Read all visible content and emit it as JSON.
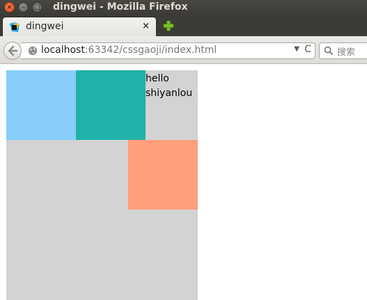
{
  "window": {
    "title": "dingwei - Mozilla Firefox",
    "close_glyph": "×",
    "min_glyph": "–",
    "max_glyph": "□"
  },
  "tab": {
    "title": "dingwei",
    "close_glyph": "×",
    "favicon": "webstorm-icon"
  },
  "newtab_icon": "plus-icon",
  "navbar": {
    "url_host": "localhost",
    "url_rest": ":63342/cssgaoji/index.html",
    "dropdown_glyph": "▼",
    "reload_glyph": "C",
    "search_placeholder": "搜索"
  },
  "page": {
    "text_line1": "hello",
    "text_line2": "shiyanlou"
  },
  "colors": {
    "container": "#d3d3d3",
    "box1": "#87cefa",
    "box2": "#20b2aa",
    "box3": "#ffa07a",
    "titlebar": "#3c3b37"
  }
}
